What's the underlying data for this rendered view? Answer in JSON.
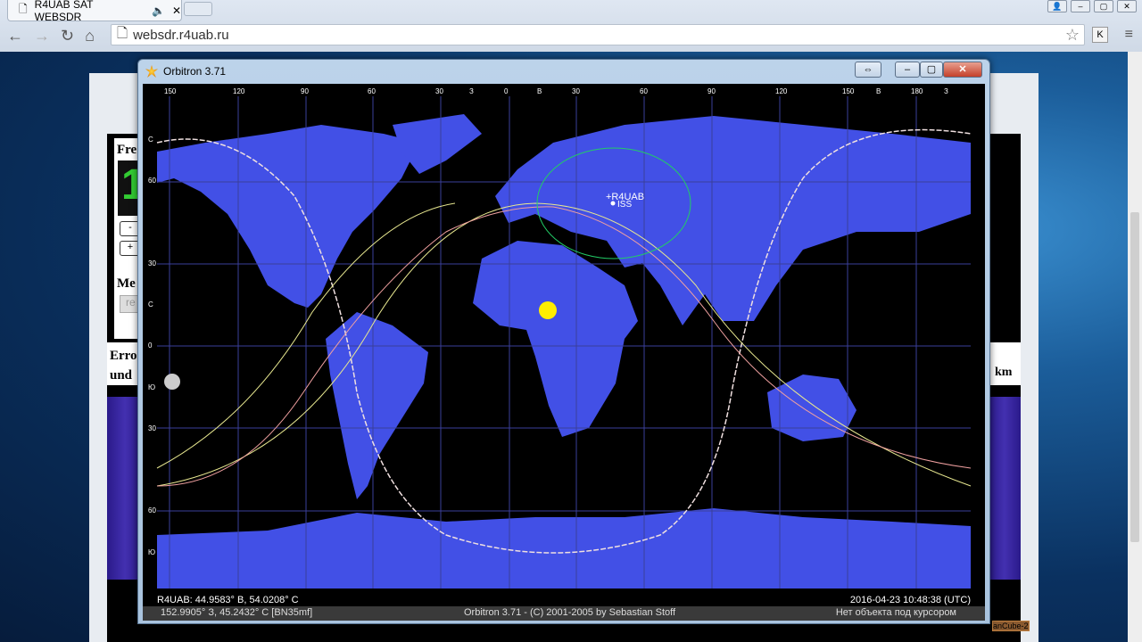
{
  "browser": {
    "tab_title": "R4UAB SAT WEBSDR",
    "url": "websdr.r4uab.ru",
    "extension_label": "K"
  },
  "webpage": {
    "freq_label": "Fre",
    "freq_digit": "1",
    "minus_label": "-",
    "plus_label": "+",
    "mem_label": "Me",
    "mem_button": "re",
    "error_line1": "Erro",
    "error_line2": "und",
    "km_label": "km",
    "sat_link": "anCube-2"
  },
  "orbitron": {
    "title": "Orbitron 3.71",
    "top_axis": [
      "150",
      "120",
      "90",
      "60",
      "30",
      "З",
      "0",
      "В",
      "30",
      "60",
      "90",
      "120",
      "150",
      "В",
      "180",
      "З"
    ],
    "left_axis": [
      "С",
      "60",
      "30",
      "С",
      "0",
      "Ю",
      "30",
      "60",
      "Ю"
    ],
    "station_label": "+R4UAB",
    "satellite_label": "ISS",
    "status_location": "R4UAB: 44.9583° В, 54.0208° С",
    "status_time": "2016-04-23 10:48:38 (UTC)",
    "cursor_coords": "152.9905° З, 45.2432° С [BN35mf]",
    "copyright": "Orbitron 3.71 - (C) 2001-2005 by Sebastian Stoff",
    "cursor_object": "Нет объекта под курсором"
  },
  "colors": {
    "land": "#4250e6",
    "ocean": "#000000",
    "grid": "#3a3f9a",
    "track1": "#e8e890",
    "track2": "#f0a0a0",
    "footprint": "#22cc66",
    "sun": "#ffee00"
  }
}
